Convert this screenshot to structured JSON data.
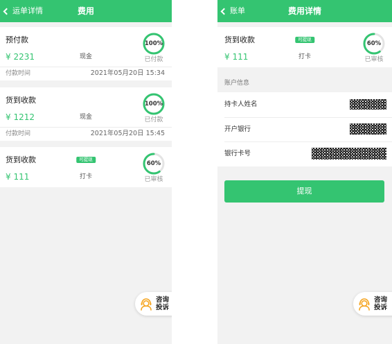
{
  "colors": {
    "brand_green": "#34c471",
    "page_gray": "#f2f2f2",
    "ring_track": "#e4e4e4",
    "icon_orange": "#f5a623"
  },
  "left_screen": {
    "header": {
      "back_icon": "chevron-left-icon",
      "back_label": "运单详情",
      "title": "费用"
    },
    "cards": [
      {
        "title": "预付款",
        "amount": "¥ 2231",
        "method": "现金",
        "progress": {
          "percent": 100,
          "label": "100%"
        },
        "status": "已付款",
        "time": {
          "label": "付款时间",
          "value": "2021年05月20日 15:34"
        }
      },
      {
        "title": "货到收款",
        "amount": "¥ 1212",
        "method": "现金",
        "progress": {
          "percent": 100,
          "label": "100%"
        },
        "status": "已付款",
        "time": {
          "label": "付款时间",
          "value": "2021年05月20日 15:45"
        }
      },
      {
        "title": "货到收款",
        "badge": "可提现",
        "amount": "¥ 111",
        "method": "打卡",
        "progress": {
          "percent": 60,
          "label": "60%"
        },
        "status": "已审核"
      }
    ],
    "service_button": {
      "icon": "customer-service-icon",
      "line1": "咨询",
      "line2": "投诉"
    }
  },
  "right_screen": {
    "header": {
      "back_icon": "chevron-left-icon",
      "back_label": "账单",
      "title": "费用详情"
    },
    "card": {
      "title": "货到收款",
      "badge": "可提现",
      "amount": "¥ 111",
      "method": "打卡",
      "progress": {
        "percent": 60,
        "label": "60%"
      },
      "status": "已审核"
    },
    "account_section": {
      "title": "账户信息",
      "rows": [
        {
          "label": "持卡人姓名"
        },
        {
          "label": "开户银行"
        },
        {
          "label": "银行卡号"
        }
      ]
    },
    "withdraw_button": {
      "label": "提现"
    },
    "service_button": {
      "icon": "customer-service-icon",
      "line1": "咨询",
      "line2": "投诉"
    }
  }
}
